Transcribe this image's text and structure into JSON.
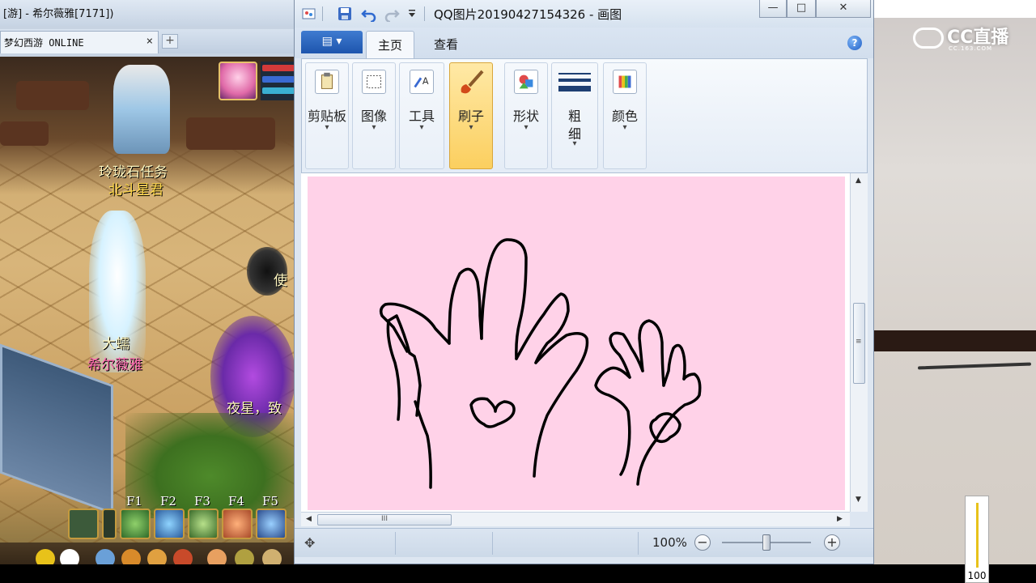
{
  "game_window": {
    "title": "[游] - 希尔薇雅[7171])",
    "tab_label": "梦幻西游 ONLINE",
    "tab_close": "×",
    "tab_add": "+",
    "labels": {
      "task": "玲珑石任务",
      "star": "北斗星君",
      "big": "大蠕",
      "player_name": "希尔薇雅",
      "right1": "使",
      "right2": "夜星，致"
    },
    "fkeys": [
      "F1",
      "F2",
      "F3",
      "F4",
      "F5"
    ]
  },
  "paint": {
    "title": "QQ图片20190427154326 - 画图",
    "window_buttons": {
      "minimize": "—",
      "maximize": "□",
      "close": "✕"
    },
    "file_tab": "▤ ▾",
    "tabs": [
      {
        "label": "主页",
        "active": true
      },
      {
        "label": "查看",
        "active": false
      }
    ],
    "help": "?",
    "groups": {
      "clipboard": "剪贴板",
      "image": "图像",
      "tools": "工具",
      "brushes": "刷子",
      "shapes": "形状",
      "size_line1": "粗",
      "size_line2": "细",
      "colors": "颜色"
    },
    "dropdown_arrow": "▾",
    "hscroll_grip": "III",
    "vscroll_grip": "≡",
    "scroll_up": "▲",
    "scroll_down": "▼",
    "scroll_left": "◀",
    "scroll_right": "▶",
    "status": {
      "move_icon": "✥",
      "zoom": "100%",
      "zoom_out": "−",
      "zoom_in": "+",
      "zoom_slider_value": 0.5
    },
    "canvas_color": "#ffd2e8",
    "ink_color": "#000000"
  },
  "stream": {
    "logo_text": "CC直播",
    "logo_sub": "CC.163.COM",
    "volume_value": "100",
    "volume_level": 1.0
  },
  "colors": {
    "accent_blue": "#1d55ad",
    "active_group": "#fbcf5f",
    "volume": "#e8c21a"
  }
}
